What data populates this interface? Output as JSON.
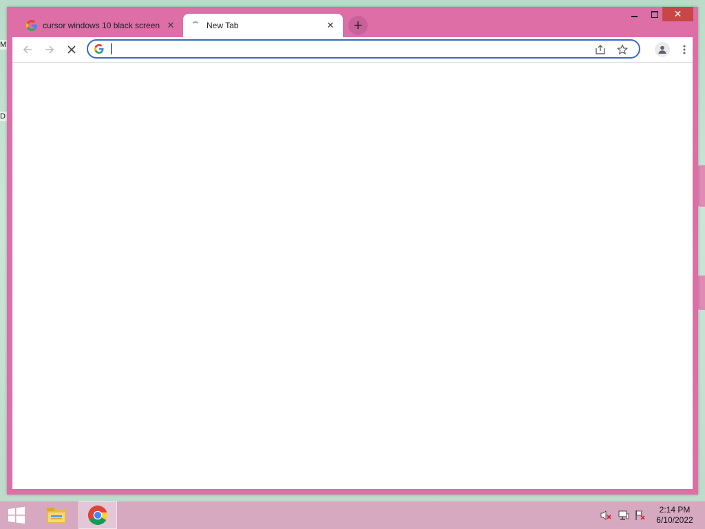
{
  "browser": {
    "tabs": [
      {
        "title": "cursor windows 10 black screen",
        "active": false,
        "favicon": "google-g-icon"
      },
      {
        "title": "New Tab",
        "active": true,
        "favicon": "loading-spinner-icon"
      }
    ],
    "address_bar": {
      "value": "",
      "placeholder": ""
    },
    "accent_color": "#dd6ea6",
    "focus_color": "#3468c9"
  },
  "desktop": {
    "fragments": [
      "M",
      "D"
    ]
  },
  "taskbar": {
    "apps": [
      {
        "name": "start",
        "icon": "windows-logo-icon"
      },
      {
        "name": "file-explorer",
        "icon": "folder-icon"
      },
      {
        "name": "chrome",
        "icon": "chrome-icon",
        "active": true
      }
    ],
    "clock": {
      "time": "2:14 PM",
      "date": "6/10/2022"
    }
  }
}
